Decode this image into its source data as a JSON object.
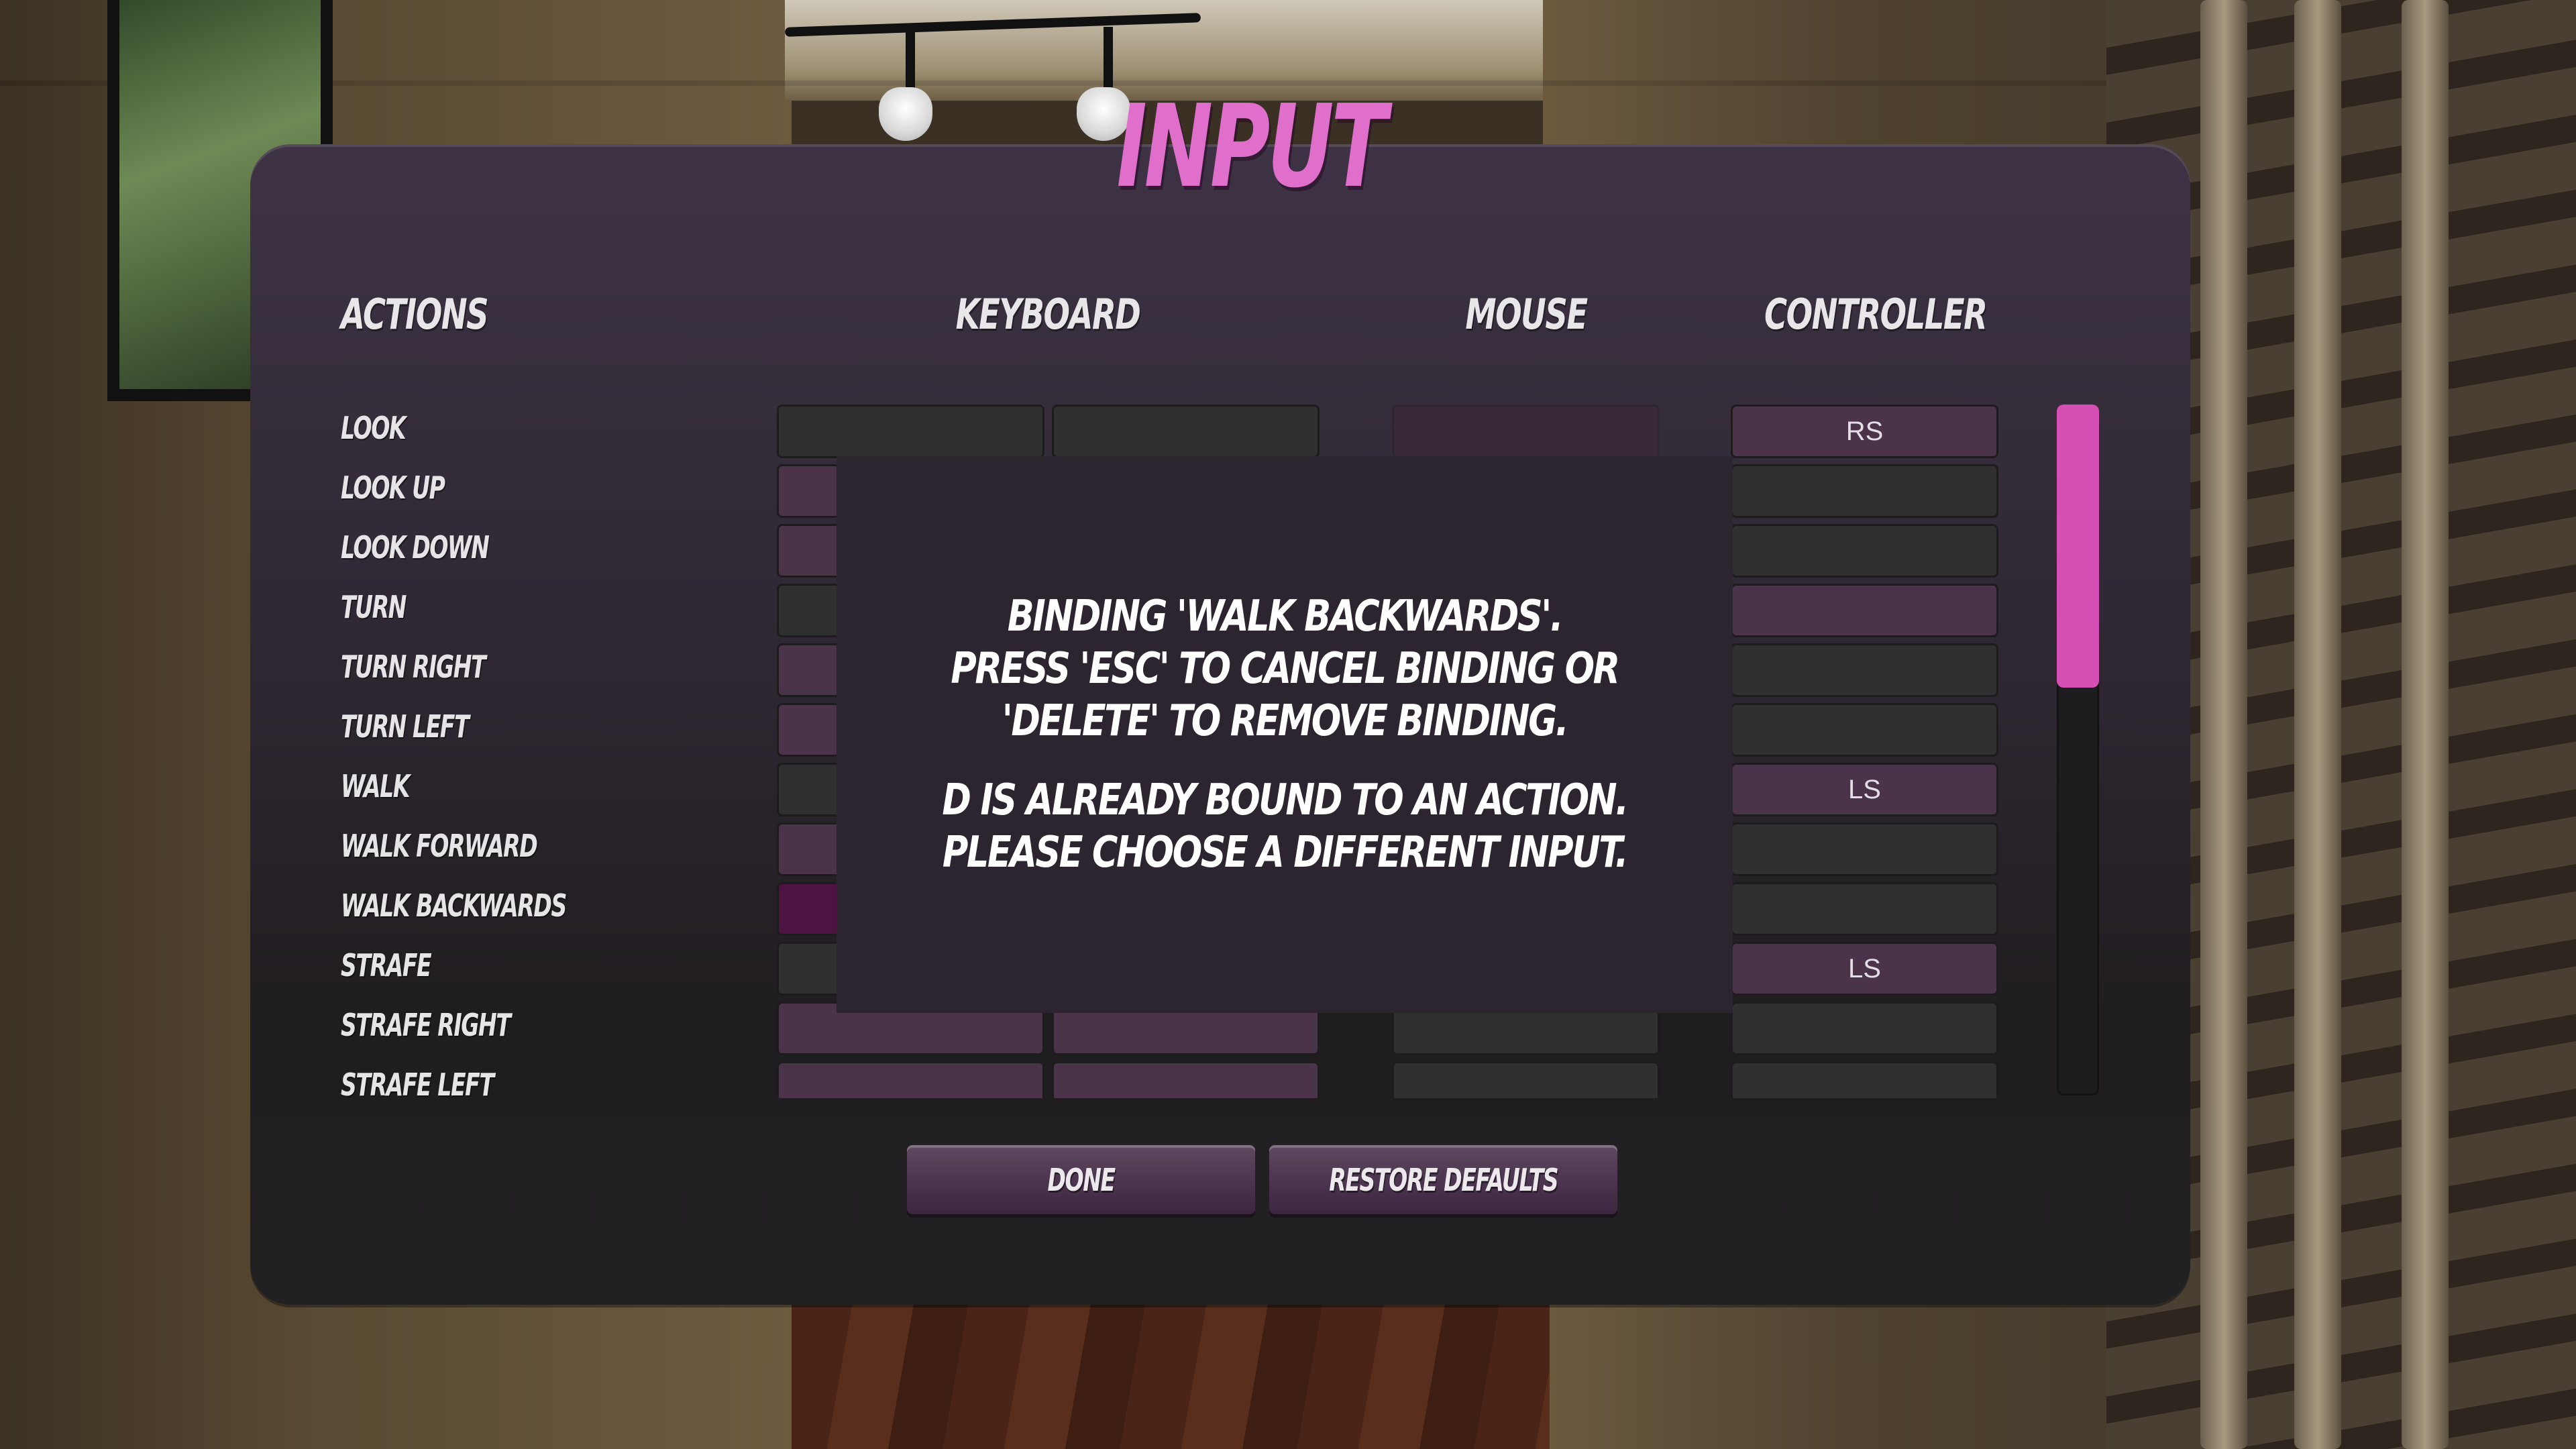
{
  "title": "INPUT",
  "columns": {
    "actions": "ACTIONS",
    "keyboard": "KEYBOARD",
    "mouse": "MOUSE",
    "controller": "CONTROLLER"
  },
  "rows": [
    {
      "action": "LOOK",
      "kb1": "",
      "kb2": "",
      "mouse": "",
      "controller": "RS",
      "kb1_state": "empty",
      "kb2_state": "empty",
      "mouse_state": "dim",
      "controller_state": "bound"
    },
    {
      "action": "LOOK UP",
      "kb1": "",
      "kb2": "",
      "mouse": "",
      "controller": "",
      "kb1_state": "bound",
      "kb2_state": "bound",
      "mouse_state": "empty",
      "controller_state": "empty"
    },
    {
      "action": "LOOK DOWN",
      "kb1": "",
      "kb2": "",
      "mouse": "",
      "controller": "",
      "kb1_state": "bound",
      "kb2_state": "bound",
      "mouse_state": "empty",
      "controller_state": "empty"
    },
    {
      "action": "TURN",
      "kb1": "",
      "kb2": "",
      "mouse": "",
      "controller": "",
      "kb1_state": "empty",
      "kb2_state": "empty",
      "mouse_state": "empty",
      "controller_state": "bound"
    },
    {
      "action": "TURN RIGHT",
      "kb1": "",
      "kb2": "",
      "mouse": "",
      "controller": "",
      "kb1_state": "bound",
      "kb2_state": "bound",
      "mouse_state": "empty",
      "controller_state": "empty"
    },
    {
      "action": "TURN LEFT",
      "kb1": "",
      "kb2": "",
      "mouse": "",
      "controller": "",
      "kb1_state": "bound",
      "kb2_state": "bound",
      "mouse_state": "empty",
      "controller_state": "empty"
    },
    {
      "action": "WALK",
      "kb1": "",
      "kb2": "",
      "mouse": "",
      "controller": "LS",
      "kb1_state": "empty",
      "kb2_state": "empty",
      "mouse_state": "empty",
      "controller_state": "bound"
    },
    {
      "action": "WALK FORWARD",
      "kb1": "",
      "kb2": "",
      "mouse": "",
      "controller": "",
      "kb1_state": "bound",
      "kb2_state": "bound",
      "mouse_state": "empty",
      "controller_state": "empty"
    },
    {
      "action": "WALK BACKWARDS",
      "kb1": "",
      "kb2": "",
      "mouse": "",
      "controller": "",
      "kb1_state": "active",
      "kb2_state": "bound",
      "mouse_state": "empty",
      "controller_state": "empty"
    },
    {
      "action": "STRAFE",
      "kb1": "",
      "kb2": "",
      "mouse": "",
      "controller": "LS",
      "kb1_state": "empty",
      "kb2_state": "empty",
      "mouse_state": "empty",
      "controller_state": "bound"
    },
    {
      "action": "STRAFE RIGHT",
      "kb1": "",
      "kb2": "",
      "mouse": "",
      "controller": "",
      "kb1_state": "bound",
      "kb2_state": "bound",
      "mouse_state": "empty",
      "controller_state": "empty"
    },
    {
      "action": "STRAFE LEFT",
      "kb1": "",
      "kb2": "",
      "mouse": "",
      "controller": "",
      "kb1_state": "bound",
      "kb2_state": "bound",
      "mouse_state": "empty",
      "controller_state": "empty"
    }
  ],
  "scrollbar": {
    "thumb_fraction": 0.41,
    "scroll_position": 0.0
  },
  "binding_dialog": {
    "line1": "BINDING 'WALK BACKWARDS'.",
    "line2": "PRESS 'ESC' TO CANCEL BINDING OR 'DELETE' TO REMOVE BINDING.",
    "line3": "D IS ALREADY BOUND TO AN ACTION. PLEASE CHOOSE A DIFFERENT INPUT."
  },
  "buttons": {
    "done": "DONE",
    "restore_defaults": "RESTORE DEFAULTS"
  },
  "colors": {
    "accent": "#e06fcc",
    "scroll_thumb": "#d54fb5",
    "cell_bound": "#4b3349",
    "cell_empty": "#303030",
    "cell_active": "#4d1442"
  }
}
